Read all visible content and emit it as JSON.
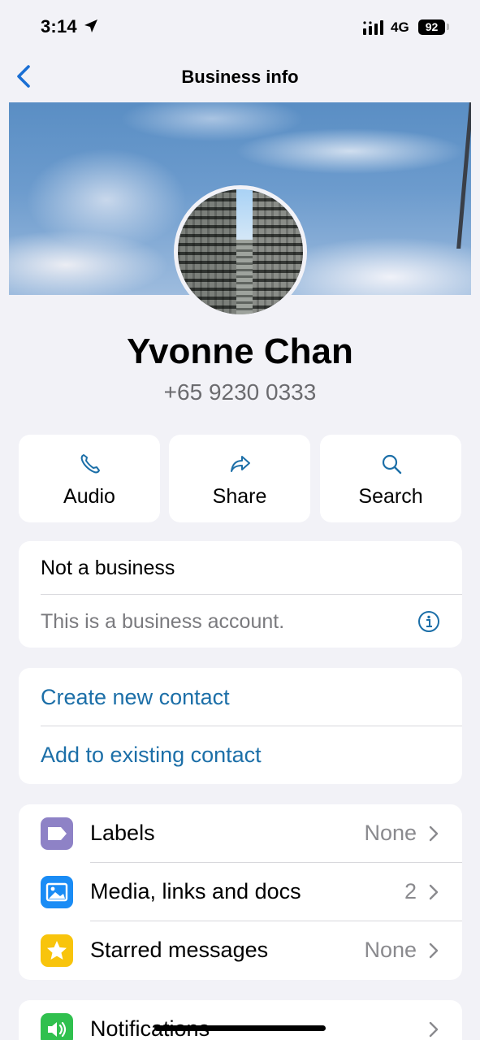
{
  "status_bar": {
    "time": "3:14",
    "network": "4G",
    "battery": "92"
  },
  "nav": {
    "title": "Business info"
  },
  "profile": {
    "name": "Yvonne Chan",
    "phone": "+65 9230 0333"
  },
  "actions": [
    {
      "label": "Audio",
      "icon": "phone-icon"
    },
    {
      "label": "Share",
      "icon": "share-arrow-icon"
    },
    {
      "label": "Search",
      "icon": "search-icon"
    }
  ],
  "business_card": {
    "title": "Not a business",
    "description": "This is a business account."
  },
  "contact_card": {
    "create": "Create new contact",
    "add": "Add to existing contact"
  },
  "menu": [
    {
      "label": "Labels",
      "value": "None",
      "icon": "label-tag-icon",
      "color": "#8e82c6"
    },
    {
      "label": "Media, links and docs",
      "value": "2",
      "icon": "photo-icon",
      "color": "#1a8cf5"
    },
    {
      "label": "Starred messages",
      "value": "None",
      "icon": "star-icon",
      "color": "#f8c40c"
    }
  ],
  "notifications": {
    "label": "Notifications",
    "icon": "speaker-icon",
    "color": "#30c04e"
  },
  "colors": {
    "accent": "#1c6fa8",
    "background": "#f2f2f7"
  }
}
